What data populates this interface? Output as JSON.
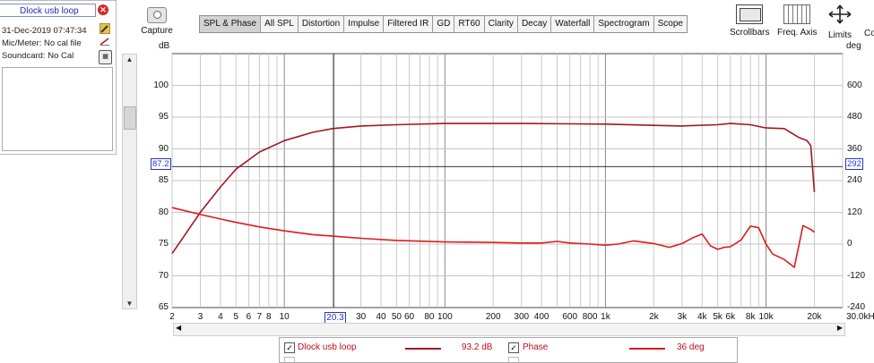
{
  "measurement": {
    "name": "Dlock usb loop",
    "date": "31-Dec-2019 07:47:34",
    "mic_meter": "Mic/Meter: No cal file",
    "soundcard": "Soundcard: No Cal"
  },
  "toolbar": {
    "capture_label": "Capture",
    "tabs": [
      "SPL & Phase",
      "All SPL",
      "Distortion",
      "Impulse",
      "Filtered IR",
      "GD",
      "RT60",
      "Clarity",
      "Decay",
      "Waterfall",
      "Spectrogram",
      "Scope"
    ],
    "active_tab": "SPL & Phase",
    "scrollbars_label": "Scrollbars",
    "freq_axis_label": "Freq. Axis",
    "limits_label": "Limits",
    "cut_label": "Co"
  },
  "chart_data": {
    "type": "line",
    "y_unit": "dB",
    "y2_unit": "deg",
    "x_unit_label": "30.0kHz",
    "xlim": [
      2,
      30000
    ],
    "x_scale": "log",
    "ylim": [
      65,
      105
    ],
    "y2lim": [
      -240,
      720
    ],
    "y_ticks": [
      "100",
      "95",
      "90",
      "85",
      "80",
      "75",
      "70",
      "65"
    ],
    "y_tick_values": [
      100,
      95,
      90,
      85,
      80,
      75,
      70,
      65
    ],
    "y2_ticks": [
      "600",
      "480",
      "360",
      "240",
      "120",
      "0",
      "-120",
      "-240"
    ],
    "y2_tick_values": [
      600,
      480,
      360,
      240,
      120,
      0,
      -120,
      -240
    ],
    "x_tick_labels": [
      "2",
      "3",
      "4",
      "5",
      "6",
      "7",
      "8",
      "10",
      "20.3",
      "30",
      "40",
      "50",
      "60",
      "80",
      "100",
      "200",
      "300",
      "400",
      "600",
      "800",
      "1k",
      "2k",
      "3k",
      "4k",
      "5k",
      "6k",
      "8k",
      "10k",
      "20k"
    ],
    "x_tick_values": [
      2,
      3,
      4,
      5,
      6,
      7,
      8,
      10,
      20.3,
      30,
      40,
      50,
      60,
      80,
      100,
      200,
      300,
      400,
      600,
      800,
      1000,
      2000,
      3000,
      4000,
      5000,
      6000,
      8000,
      10000,
      20000
    ],
    "cursor": {
      "x_label": "20.3",
      "x": 20.3,
      "y_label": "87.2",
      "y": 87.2,
      "y2_label": "292"
    },
    "grid": true,
    "series": [
      {
        "name": "Dlock usb loop",
        "color": "#a31621",
        "axis": "left",
        "x": [
          2,
          3,
          4,
          5,
          7,
          10,
          15,
          20,
          30,
          50,
          100,
          300,
          1000,
          2000,
          3000,
          5000,
          6000,
          8000,
          10000,
          13000,
          16000,
          18000,
          19000,
          20000
        ],
        "y": [
          73.5,
          80,
          84,
          86.8,
          89.5,
          91.3,
          92.6,
          93.2,
          93.6,
          93.8,
          94,
          94,
          93.9,
          93.7,
          93.6,
          93.8,
          94,
          93.8,
          93.3,
          93.2,
          91.8,
          91.3,
          90.5,
          83.2
        ]
      },
      {
        "name": "Phase",
        "color": "#e01a1a",
        "axis": "right",
        "x": [
          2,
          3,
          4,
          5,
          7,
          10,
          15,
          20,
          30,
          50,
          100,
          200,
          300,
          400,
          500,
          600,
          800,
          1000,
          1200,
          1500,
          2000,
          2500,
          3000,
          3500,
          4000,
          4500,
          5000,
          5500,
          6000,
          7000,
          8000,
          9000,
          10000,
          11000,
          13000,
          15000,
          17000,
          19000,
          20000
        ],
        "y": [
          138,
          112,
          95,
          82,
          65,
          50,
          36,
          30,
          22,
          14,
          8,
          6,
          4,
          4,
          10,
          4,
          0,
          -4,
          0,
          12,
          2,
          -12,
          2,
          24,
          38,
          -6,
          -20,
          -12,
          -10,
          16,
          68,
          62,
          0,
          -38,
          -58,
          -88,
          70,
          55,
          45
        ]
      }
    ]
  },
  "legend": [
    {
      "label": "Dlock usb loop",
      "value": "93.2 dB",
      "checked": true,
      "color": "#a31621"
    },
    {
      "label": "Phase",
      "value": "36 deg",
      "checked": true,
      "color": "#e01a1a"
    }
  ]
}
